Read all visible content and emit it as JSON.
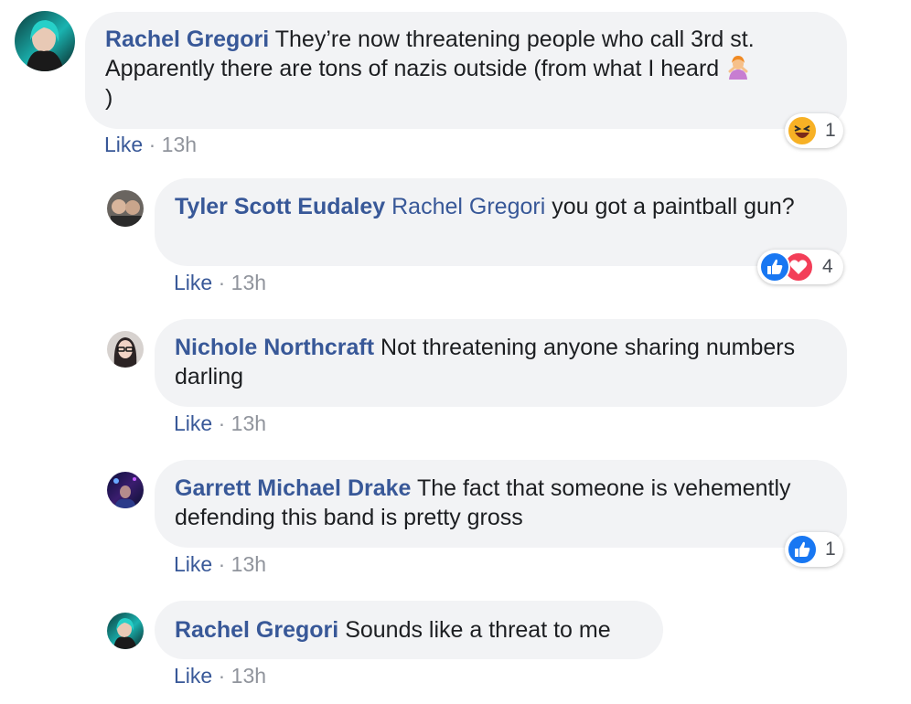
{
  "comments": [
    {
      "author": "Rachel Gregori",
      "text": "They’re now threatening people who call 3rd st. Apparently there are tons of nazis outside (from what I heard",
      "text_end": ")",
      "emoji": "person-gesturing-no-emoji",
      "like_label": "Like",
      "sep": "·",
      "time": "13h",
      "reactions": {
        "icons": [
          "haha-reaction-icon"
        ],
        "count": "1"
      }
    },
    {
      "author": "Tyler Scott Eudaley",
      "mention": "Rachel Gregori",
      "text": "you got a paintball gun?",
      "like_label": "Like",
      "sep": "·",
      "time": "13h",
      "reactions": {
        "icons": [
          "like-reaction-icon",
          "love-reaction-icon"
        ],
        "count": "4"
      }
    },
    {
      "author": "Nichole Northcraft",
      "text": "Not threatening anyone sharing numbers darling",
      "like_label": "Like",
      "sep": "·",
      "time": "13h"
    },
    {
      "author": "Garrett Michael Drake",
      "text": "The fact that someone is vehemently defending this band is pretty gross",
      "like_label": "Like",
      "sep": "·",
      "time": "13h",
      "reactions": {
        "icons": [
          "like-reaction-icon"
        ],
        "count": "1"
      }
    },
    {
      "author": "Rachel Gregori",
      "text": "Sounds like a threat to me",
      "like_label": "Like",
      "sep": "·",
      "time": "13h"
    }
  ],
  "colors": {
    "link": "#385898",
    "bubble": "#f2f3f5",
    "meta": "#90949c",
    "like_blue": "#1877f2",
    "love_red": "#f33e58",
    "haha_yellow": "#f7b125"
  }
}
